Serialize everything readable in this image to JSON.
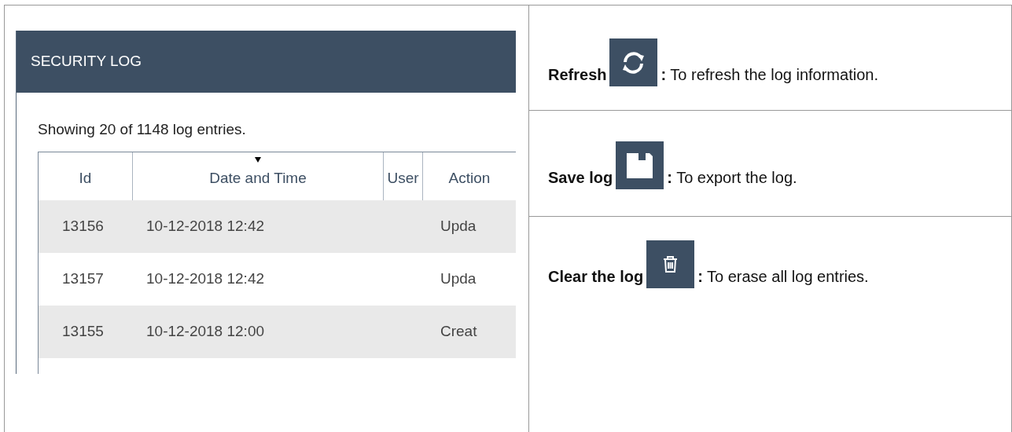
{
  "app_panel": {
    "title": "SECURITY LOG",
    "summary": "Showing 20 of 1148 log entries.",
    "columns": [
      {
        "label": "Id",
        "sorted": false
      },
      {
        "label": "Date and Time",
        "sorted": true
      },
      {
        "label": "User",
        "sorted": false
      },
      {
        "label": "Action",
        "sorted": false
      }
    ],
    "rows": [
      {
        "id": "13156",
        "date": "10-12-2018 12:42",
        "user": "",
        "action": "Upda"
      },
      {
        "id": "13157",
        "date": "10-12-2018 12:42",
        "user": "",
        "action": "Upda"
      },
      {
        "id": "13155",
        "date": "10-12-2018 12:00",
        "user": "",
        "action": "Creat"
      }
    ]
  },
  "descriptions": [
    {
      "kind": "refresh",
      "label": "Refresh",
      "text": "**:** To refresh the log information."
    },
    {
      "kind": "save",
      "label": "Save log",
      "text": "**:** To export the log."
    },
    {
      "kind": "delete",
      "label": "Clear the log",
      "text": "**:** To erase all log entries."
    }
  ]
}
